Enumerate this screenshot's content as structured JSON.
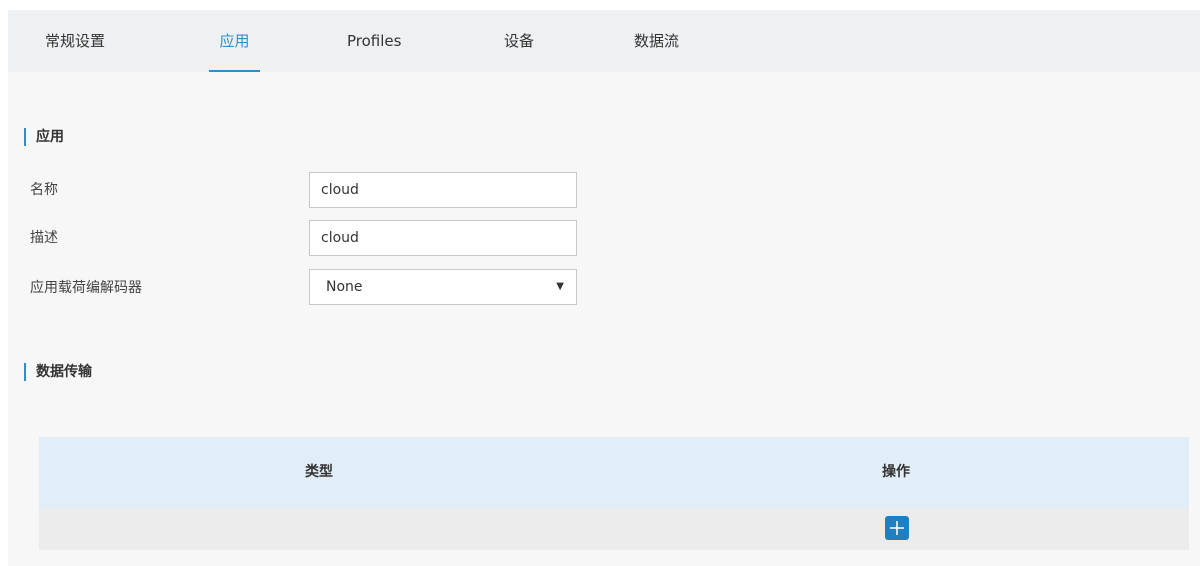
{
  "tabs": [
    {
      "label": "常规设置",
      "active": false
    },
    {
      "label": "应用",
      "active": true
    },
    {
      "label": "Profiles",
      "active": false
    },
    {
      "label": "设备",
      "active": false
    },
    {
      "label": "数据流",
      "active": false
    }
  ],
  "app_section": {
    "title": "应用",
    "name_label": "名称",
    "name_value": "cloud",
    "description_label": "描述",
    "description_value": "cloud",
    "codec_label": "应用载荷编解码器",
    "codec_value": "None"
  },
  "transfer_section": {
    "title": "数据传输",
    "columns": [
      "类型",
      "操作"
    ],
    "add_icon": "plus-icon"
  },
  "colors": {
    "accent": "#2d8ec9",
    "button": "#1f7fbf",
    "table_header": "#e1edf7"
  }
}
